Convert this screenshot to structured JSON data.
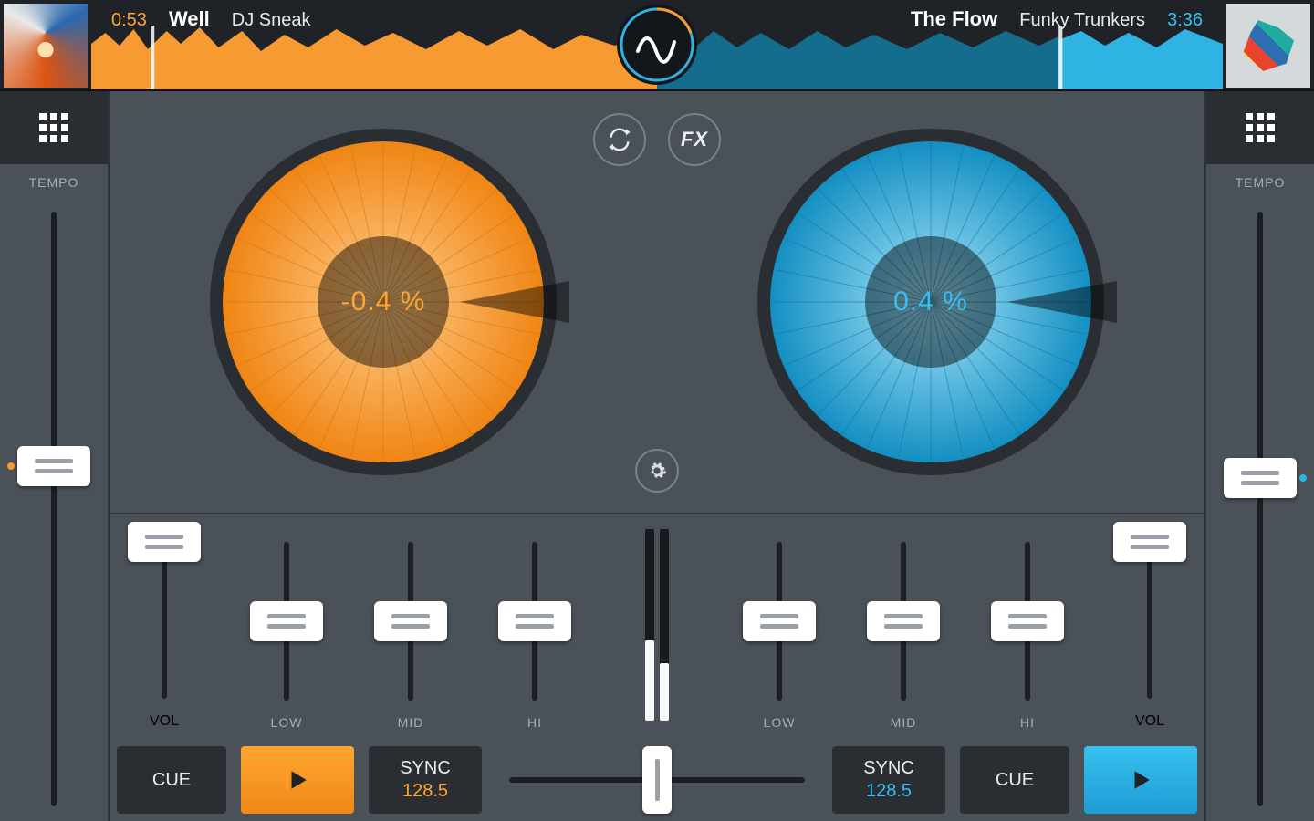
{
  "deckA": {
    "time": "0:53",
    "title": "Well",
    "artist": "DJ Sneak",
    "pitch": "-0.4 %",
    "bpm": "128.5",
    "color": "#f79a32"
  },
  "deckB": {
    "time": "3:36",
    "title": "The Flow",
    "artist": "Funky Trunkers",
    "pitch": "0.4 %",
    "bpm": "128.5",
    "color": "#2fb3e3"
  },
  "labels": {
    "tempo": "TEMPO",
    "vol": "VOL",
    "low": "LOW",
    "mid": "MID",
    "hi": "HI",
    "cue": "CUE",
    "sync": "SYNC",
    "fx": "FX"
  },
  "sliders": {
    "tempoA_pos": 0.43,
    "tempoB_pos": 0.45,
    "volA_pos": 0.06,
    "volB_pos": 0.06,
    "eqA": {
      "low": 0.5,
      "mid": 0.5,
      "hi": 0.5
    },
    "eqB": {
      "low": 0.5,
      "mid": 0.5,
      "hi": 0.5
    },
    "crossfader": 0.5,
    "meterA": 0.42,
    "meterB": 0.3
  }
}
